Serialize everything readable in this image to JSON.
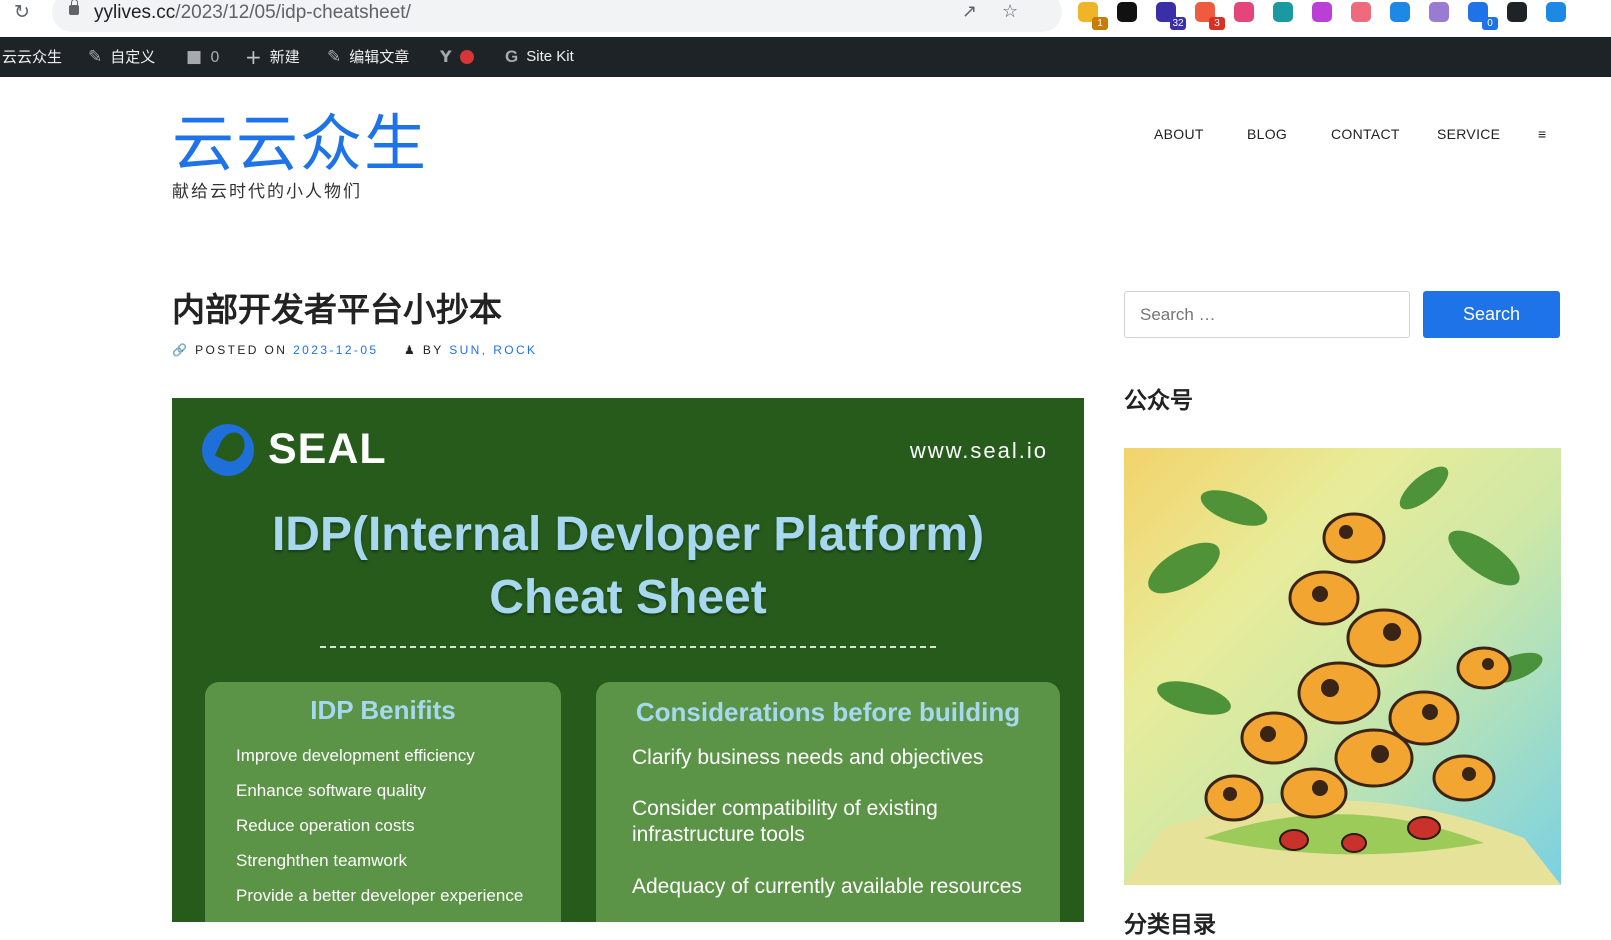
{
  "browser": {
    "url_host": "yylives.cc",
    "url_path": "/2023/12/05/idp-cheatsheet/",
    "extensions": [
      {
        "name": "ext-1",
        "color": "#f0b429",
        "badge": "1",
        "badge_color": "#c77c02"
      },
      {
        "name": "notion",
        "color": "#111111",
        "badge": "",
        "badge_color": ""
      },
      {
        "name": "ext-graduate",
        "color": "#3a2fa8",
        "badge": "32",
        "badge_color": "#3a2fa8"
      },
      {
        "name": "ext-4",
        "color": "#ef5b3f",
        "badge": "3",
        "badge_color": "#d93025"
      },
      {
        "name": "ext-translate",
        "color": "#e5457a",
        "badge": "",
        "badge_color": ""
      },
      {
        "name": "ext-6",
        "color": "#1a9aa0",
        "badge": "",
        "badge_color": ""
      },
      {
        "name": "ext-7",
        "color": "#b93fd6",
        "badge": "",
        "badge_color": ""
      },
      {
        "name": "ext-8",
        "color": "#ef6a7a",
        "badge": "",
        "badge_color": ""
      },
      {
        "name": "ext-9",
        "color": "#1e88e5",
        "badge": "",
        "badge_color": ""
      },
      {
        "name": "ext-openai",
        "color": "#9a7bd4",
        "badge": "",
        "badge_color": ""
      },
      {
        "name": "ext-11",
        "color": "#1e73e8",
        "badge": "0",
        "badge_color": "#1e73e8"
      },
      {
        "name": "ext-12",
        "color": "#1d2327",
        "badge": "",
        "badge_color": ""
      },
      {
        "name": "ext-13",
        "color": "#1e88e5",
        "badge": "",
        "badge_color": ""
      }
    ]
  },
  "admin_bar": {
    "site_name": "云云众生",
    "customize": "自定义",
    "comments_count": "0",
    "new": "新建",
    "edit_post": "编辑文章",
    "site_kit": "Site Kit"
  },
  "site": {
    "title": "云云众生",
    "tagline": "献给云时代的小人物们"
  },
  "nav": [
    "ABOUT",
    "BLOG",
    "CONTACT",
    "SERVICE",
    "≡"
  ],
  "post": {
    "title": "内部开发者平台小抄本",
    "posted_on_label": "POSTED ON",
    "date": "2023-12-05",
    "by_label": "BY",
    "author": "SUN, ROCK"
  },
  "cheatsheet": {
    "brand": "SEAL",
    "url": "www.seal.io",
    "title_line1": "IDP(Internal Devloper Platform)",
    "title_line2": "Cheat Sheet",
    "benefits_title": "IDP Benifits",
    "benefits": [
      "Improve development efficiency",
      "Enhance software quality",
      "Reduce operation costs",
      "Strenghthen teamwork",
      "Provide a better developer experience"
    ],
    "considerations_title": "Considerations before building",
    "considerations": [
      "Clarify business needs and objectives",
      "Consider compatibility of existing",
      "infrastructure tools",
      "Adequacy of currently available resources"
    ]
  },
  "sidebar": {
    "search_placeholder": "Search …",
    "search_button": "Search",
    "widget_title": "公众号",
    "widget_title_2": "分类目录"
  },
  "colors": {
    "brand": "#1e73e8",
    "admin_bar": "#1d2327",
    "cheatsheet_bg": "#265b1c",
    "card_bg": "#5b9347"
  }
}
